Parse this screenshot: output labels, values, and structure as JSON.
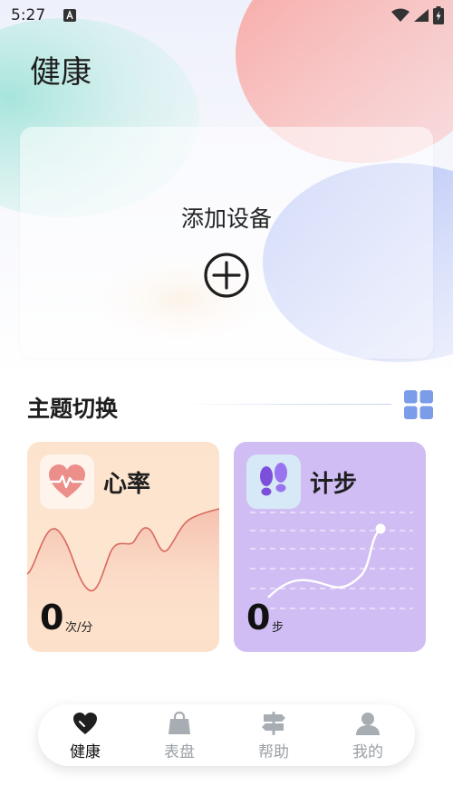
{
  "statusbar": {
    "time": "5:27",
    "notification_icon": "text-a-icon",
    "icons": [
      "wifi-icon",
      "signal-icon",
      "battery-charging-icon"
    ]
  },
  "header": {
    "title": "健康"
  },
  "add_device": {
    "label": "添加设备",
    "icon": "plus-circle-icon"
  },
  "theme_section": {
    "title": "主题切换",
    "icon": "grid-four-icon",
    "accent": "#7b9ce8"
  },
  "cards": [
    {
      "title": "心率",
      "icon": "heart-pulse-icon",
      "value": "0",
      "unit": "次/分",
      "color": "#fde4cf",
      "accent": "#e8928a"
    },
    {
      "title": "计步",
      "icon": "footprints-icon",
      "value": "0",
      "unit": "步",
      "color": "#cfbdf4",
      "accent": "#7b4fd9"
    }
  ],
  "tabbar": {
    "tabs": [
      {
        "label": "健康",
        "icon": "heart-icon",
        "active": true
      },
      {
        "label": "表盘",
        "icon": "shopping-bag-icon",
        "active": false
      },
      {
        "label": "帮助",
        "icon": "signpost-icon",
        "active": false
      },
      {
        "label": "我的",
        "icon": "user-icon",
        "active": false
      }
    ]
  }
}
